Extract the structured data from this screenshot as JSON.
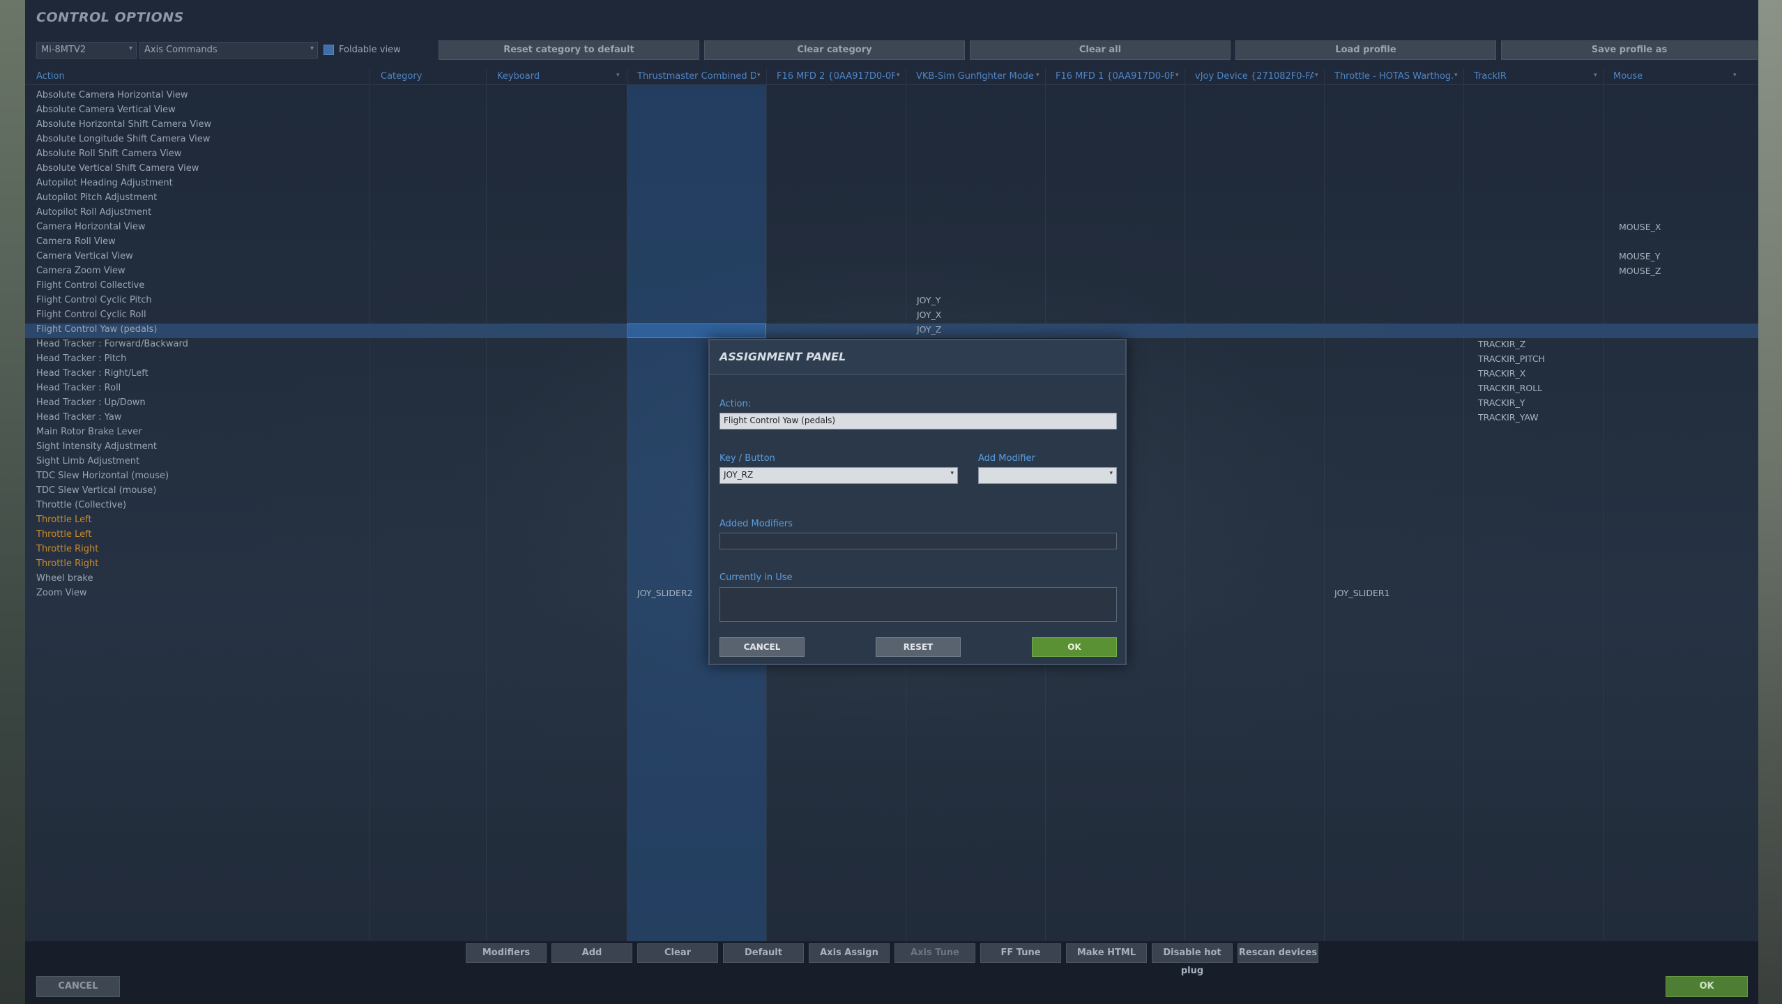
{
  "window": {
    "title": "CONTROL OPTIONS"
  },
  "toolbar": {
    "aircraft": "Mi-8MTV2",
    "category": "Axis Commands",
    "foldable_label": "Foldable view",
    "buttons": [
      "Reset category to default",
      "Clear category",
      "Clear all",
      "Load profile",
      "Save profile as"
    ]
  },
  "columns": [
    "Action",
    "Category",
    "Keyboard",
    "Thrustmaster Combined D...",
    "F16 MFD 2 {0AA917D0-0F...",
    "VKB-Sim Gunfighter Mode...",
    "F16 MFD 1 {0AA917D0-0F...",
    "vJoy Device {271082F0-FA...",
    "Throttle - HOTAS Warthog...",
    "TrackIR",
    "Mouse"
  ],
  "rows": [
    {
      "action": "Absolute Camera Horizontal View"
    },
    {
      "action": "Absolute Camera Vertical View"
    },
    {
      "action": "Absolute Horizontal Shift Camera View"
    },
    {
      "action": "Absolute Longitude Shift Camera View"
    },
    {
      "action": "Absolute Roll Shift Camera View"
    },
    {
      "action": "Absolute Vertical Shift Camera View"
    },
    {
      "action": "Autopilot Heading Adjustment"
    },
    {
      "action": "Autopilot Pitch Adjustment"
    },
    {
      "action": "Autopilot Roll Adjustment"
    },
    {
      "action": "Camera Horizontal View",
      "mouse": "MOUSE_X"
    },
    {
      "action": "Camera Roll View"
    },
    {
      "action": "Camera Vertical View",
      "mouse": "MOUSE_Y"
    },
    {
      "action": "Camera Zoom View",
      "mouse": "MOUSE_Z"
    },
    {
      "action": "Flight Control Collective"
    },
    {
      "action": "Flight Control Cyclic Pitch",
      "vkb": "JOY_Y"
    },
    {
      "action": "Flight Control Cyclic Roll",
      "vkb": "JOY_X"
    },
    {
      "action": "Flight Control Yaw (pedals)",
      "vkb": "JOY_Z",
      "selected": true
    },
    {
      "action": "Head Tracker : Forward/Backward",
      "trackir": "TRACKIR_Z"
    },
    {
      "action": "Head Tracker : Pitch",
      "trackir": "TRACKIR_PITCH"
    },
    {
      "action": "Head Tracker : Right/Left",
      "trackir": "TRACKIR_X"
    },
    {
      "action": "Head Tracker : Roll",
      "trackir": "TRACKIR_ROLL"
    },
    {
      "action": "Head Tracker : Up/Down",
      "trackir": "TRACKIR_Y"
    },
    {
      "action": "Head Tracker : Yaw",
      "trackir": "TRACKIR_YAW"
    },
    {
      "action": "Main Rotor Brake Lever"
    },
    {
      "action": "Sight Intensity Adjustment"
    },
    {
      "action": "Sight Limb Adjustment"
    },
    {
      "action": "TDC Slew Horizontal (mouse)"
    },
    {
      "action": "TDC Slew Vertical (mouse)"
    },
    {
      "action": "Throttle (Collective)"
    },
    {
      "action": "Throttle Left",
      "orange": true
    },
    {
      "action": "Throttle Left",
      "orange": true
    },
    {
      "action": "Throttle Right",
      "orange": true
    },
    {
      "action": "Throttle Right",
      "orange": true
    },
    {
      "action": "Wheel brake"
    },
    {
      "action": "Zoom View",
      "thrustmaster": "JOY_SLIDER2",
      "vkb": "JOY_SLIDER2",
      "throttle": "JOY_SLIDER1"
    }
  ],
  "assignment_panel": {
    "title": "ASSIGNMENT PANEL",
    "action_label": "Action:",
    "action_value": "Flight Control Yaw (pedals)",
    "key_label": "Key / Button",
    "key_value": "JOY_RZ",
    "modifier_label": "Add Modifier",
    "modifier_value": "",
    "added_modifiers_label": "Added Modifiers",
    "added_modifiers_value": "",
    "in_use_label": "Currently in Use",
    "in_use_value": "",
    "cancel": "CANCEL",
    "reset": "RESET",
    "ok": "OK"
  },
  "bottom_toolbar": [
    "Modifiers",
    "Add",
    "Clear",
    "Default",
    "Axis Assign",
    "Axis Tune",
    "FF Tune",
    "Make HTML",
    "Disable hot plug",
    "Rescan devices"
  ],
  "footer": {
    "cancel": "CANCEL",
    "ok": "OK"
  },
  "colors": {
    "accent_blue": "#4f85c6",
    "orange_text": "#c98a2a",
    "ok_green": "#5a9134"
  }
}
